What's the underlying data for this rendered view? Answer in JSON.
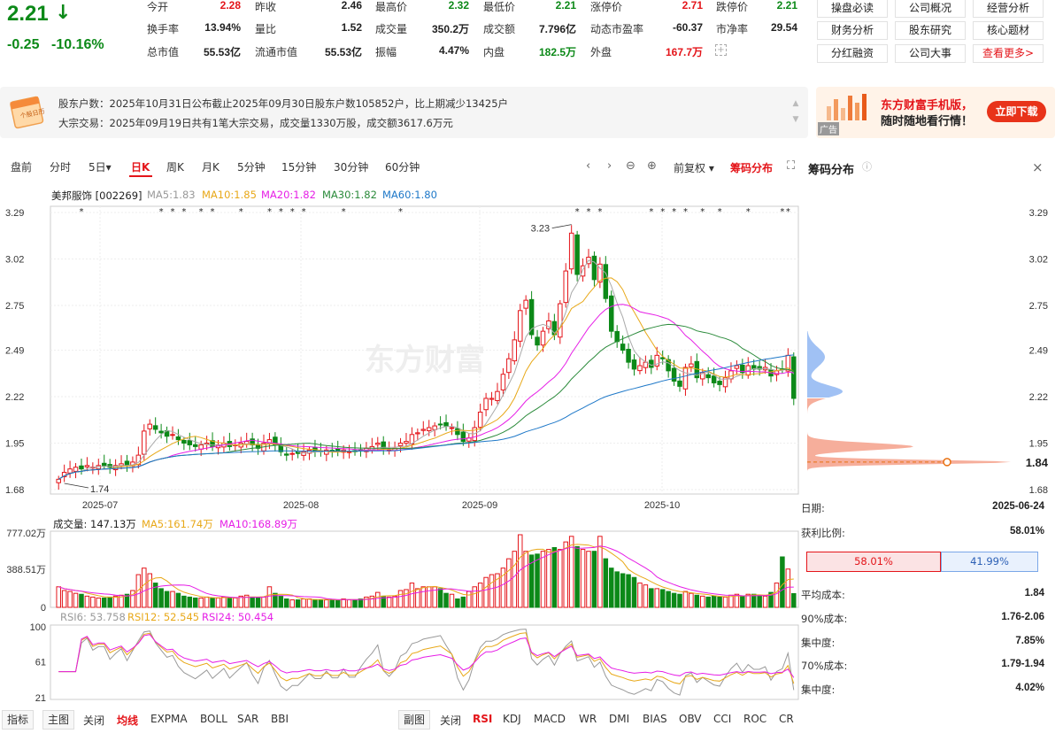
{
  "quote": {
    "price": "2.21",
    "change": "-0.25",
    "change_pct": "-10.16%",
    "fields": [
      {
        "label": "今开",
        "value": "2.28",
        "color": "red"
      },
      {
        "label": "昨收",
        "value": "2.46",
        "color": "dark"
      },
      {
        "label": "最高价",
        "value": "2.32",
        "color": "green"
      },
      {
        "label": "最低价",
        "value": "2.21",
        "color": "green"
      },
      {
        "label": "涨停价",
        "value": "2.71",
        "color": "red"
      },
      {
        "label": "跌停价",
        "value": "2.21",
        "color": "green"
      },
      {
        "label": "换手率",
        "value": "13.94%",
        "color": "dark"
      },
      {
        "label": "量比",
        "value": "1.52",
        "color": "dark"
      },
      {
        "label": "成交量",
        "value": "350.2万",
        "color": "dark"
      },
      {
        "label": "成交额",
        "value": "7.796亿",
        "color": "dark"
      },
      {
        "label": "动态市盈率",
        "value": "-60.37",
        "color": "dark"
      },
      {
        "label": "市净率",
        "value": "29.54",
        "color": "dark"
      },
      {
        "label": "总市值",
        "value": "55.53亿",
        "color": "dark"
      },
      {
        "label": "流通市值",
        "value": "55.53亿",
        "color": "dark"
      },
      {
        "label": "振幅",
        "value": "4.47%",
        "color": "dark"
      },
      {
        "label": "内盘",
        "value": "182.5万",
        "color": "green"
      },
      {
        "label": "外盘",
        "value": "167.7万",
        "color": "red"
      }
    ],
    "buttons": [
      "操盘必读",
      "公司概况",
      "经营分析",
      "财务分析",
      "股东研究",
      "核心题材",
      "分红融资",
      "公司大事",
      "查看更多>"
    ]
  },
  "info": {
    "calendar_label": "个股日历",
    "line1": "股东户数：2025年10月31日公布截止2025年09月30日股东户数105852户，比上期减少13425户",
    "line2": "大宗交易：2025年09月19日共有1笔大宗交易，成交量1330万股，成交额3617.6万元"
  },
  "ad": {
    "line1": "东方财富手机版，",
    "line2": "随时随地看行情！",
    "button": "立即下载",
    "tag": "广告"
  },
  "toolbar": {
    "periods": [
      "盘前",
      "分时",
      "5日▾",
      "日K",
      "周K",
      "月K",
      "5分钟",
      "15分钟",
      "30分钟",
      "60分钟"
    ],
    "active_period": "日K",
    "adjust": "前复权 ▾",
    "chip_toggle": "筹码分布",
    "panel_title": "筹码分布"
  },
  "main_legend": {
    "name": "美邦服饰 [002269]",
    "ma5": "MA5:1.83",
    "ma10": "MA10:1.85",
    "ma20": "MA20:1.82",
    "ma30": "MA30:1.82",
    "ma60": "MA60:1.80"
  },
  "volume_legend": {
    "vol": "成交量: 147.13万",
    "ma5": "MA5:161.74万",
    "ma10": "MA10:168.89万"
  },
  "rsi_legend": {
    "rsi6": "RSI6: 53.758",
    "rsi12": "RSI12: 52.545",
    "rsi24": "RSI24: 50.454"
  },
  "chips": {
    "date_label": "日期:",
    "date": "2025-06-24",
    "profit_label": "获利比例:",
    "profit": "58.01%",
    "bar_profit": "58.01%",
    "bar_loss": "41.99%",
    "rows": [
      {
        "label": "平均成本:",
        "value": "1.84"
      },
      {
        "label": "90%成本:",
        "value": "1.76-2.06"
      },
      {
        "label": "集中度:",
        "value": "7.85%"
      },
      {
        "label": "70%成本:",
        "value": "1.79-1.94"
      },
      {
        "label": "集中度:",
        "value": "4.02%"
      }
    ],
    "axis": [
      "3.29",
      "3.02",
      "2.75",
      "2.49",
      "2.22",
      "1.95",
      "1.84",
      "1.68"
    ]
  },
  "bottom": {
    "left": [
      "指标",
      "主图",
      "关闭",
      "均线",
      "EXPMA",
      "BOLL",
      "SAR",
      "BBI"
    ],
    "right": [
      "副图",
      "关闭",
      "RSI",
      "KDJ",
      "MACD",
      "WR",
      "DMI",
      "BIAS",
      "OBV",
      "CCI",
      "ROC",
      "CR"
    ]
  },
  "chart_data": {
    "type": "candlestick",
    "watermark": "东方财富",
    "price_axis": [
      "3.29",
      "3.02",
      "2.75",
      "2.49",
      "2.22",
      "1.95",
      "1.68"
    ],
    "price_range": [
      1.68,
      3.29
    ],
    "date_axis": [
      "2025-07",
      "2025-08",
      "2025-09",
      "2025-10"
    ],
    "annotations": [
      {
        "label": "3.23"
      },
      {
        "label": "1.74"
      }
    ],
    "volume_axis": [
      "777.02万",
      "388.51万",
      "0"
    ],
    "volume_max": 777.02,
    "rsi_axis": [
      "100",
      "61",
      "21"
    ],
    "rsi_range": [
      21,
      100
    ],
    "colors": {
      "up": "#e4151a",
      "down": "#0c8918",
      "ma5": "#aaaaaa",
      "ma10": "#e8a818",
      "ma20": "#e61ee6",
      "ma30": "#2a8a3a",
      "ma60": "#1e78c8",
      "rsi6": "#999999",
      "rsi12": "#e8a818",
      "rsi24": "#e61ee6"
    },
    "closes": [
      1.74,
      1.78,
      1.8,
      1.81,
      1.8,
      1.82,
      1.81,
      1.82,
      1.82,
      1.81,
      1.82,
      1.83,
      1.82,
      1.84,
      1.88,
      2.02,
      2.06,
      2.03,
      2.01,
      1.99,
      2.0,
      1.97,
      1.95,
      1.94,
      1.93,
      1.94,
      1.95,
      1.93,
      1.94,
      1.95,
      1.93,
      1.94,
      1.95,
      1.96,
      1.94,
      1.92,
      1.95,
      1.97,
      1.94,
      1.9,
      1.88,
      1.89,
      1.89,
      1.9,
      1.91,
      1.9,
      1.9,
      1.91,
      1.9,
      1.9,
      1.91,
      1.9,
      1.9,
      1.91,
      1.92,
      1.93,
      1.95,
      1.92,
      1.91,
      1.92,
      1.95,
      1.96,
      2.0,
      2.01,
      2.03,
      2.04,
      2.05,
      2.06,
      2.05,
      2.04,
      2.0,
      1.96,
      1.98,
      2.04,
      2.13,
      2.21,
      2.21,
      2.25,
      2.35,
      2.44,
      2.55,
      2.72,
      2.78,
      2.58,
      2.52,
      2.6,
      2.66,
      2.58,
      2.76,
      2.95,
      3.17,
      2.93,
      2.98,
      3.03,
      2.9,
      2.99,
      2.79,
      2.6,
      2.54,
      2.49,
      2.42,
      2.38,
      2.4,
      2.42,
      2.39,
      2.46,
      2.44,
      2.37,
      2.31,
      2.28,
      2.39,
      2.41,
      2.33,
      2.36,
      2.33,
      2.3,
      2.29,
      2.33,
      2.37,
      2.4,
      2.36,
      2.4,
      2.38,
      2.38,
      2.39,
      2.34,
      2.37,
      2.38,
      2.46,
      2.21
    ],
    "volumes": [
      220,
      180,
      170,
      150,
      140,
      120,
      110,
      100,
      100,
      110,
      120,
      130,
      140,
      180,
      350,
      420,
      360,
      260,
      200,
      170,
      170,
      150,
      120,
      110,
      100,
      100,
      110,
      100,
      100,
      110,
      100,
      100,
      120,
      130,
      110,
      100,
      110,
      220,
      150,
      120,
      90,
      80,
      80,
      90,
      90,
      80,
      80,
      80,
      80,
      80,
      90,
      80,
      80,
      90,
      110,
      120,
      160,
      120,
      110,
      120,
      180,
      190,
      260,
      200,
      220,
      220,
      220,
      200,
      150,
      140,
      90,
      110,
      170,
      220,
      260,
      320,
      350,
      360,
      420,
      520,
      600,
      777,
      600,
      560,
      570,
      600,
      620,
      640,
      620,
      700,
      760,
      650,
      620,
      600,
      600,
      760,
      520,
      420,
      380,
      360,
      350,
      320,
      260,
      240,
      200,
      200,
      190,
      170,
      150,
      140,
      170,
      150,
      130,
      120,
      110,
      120,
      110,
      110,
      130,
      140,
      120,
      140,
      140,
      130,
      120,
      160,
      260,
      540,
      410,
      147
    ],
    "rsi6_end": 53.758,
    "rsi12_end": 52.545,
    "rsi24_end": 50.454
  }
}
